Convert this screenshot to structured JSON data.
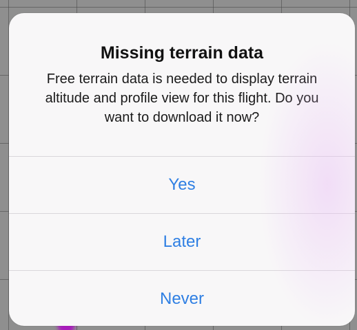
{
  "alert": {
    "title": "Missing terrain data",
    "message": "Free terrain data is needed to display terrain altitude and profile view for this flight. Do you want to download it now?",
    "buttons": [
      {
        "label": "Yes"
      },
      {
        "label": "Later"
      },
      {
        "label": "Never"
      }
    ]
  },
  "colors": {
    "button_text": "#2f7fe3",
    "alert_background": "#f8f7f8",
    "route_line": "#b000c8"
  }
}
